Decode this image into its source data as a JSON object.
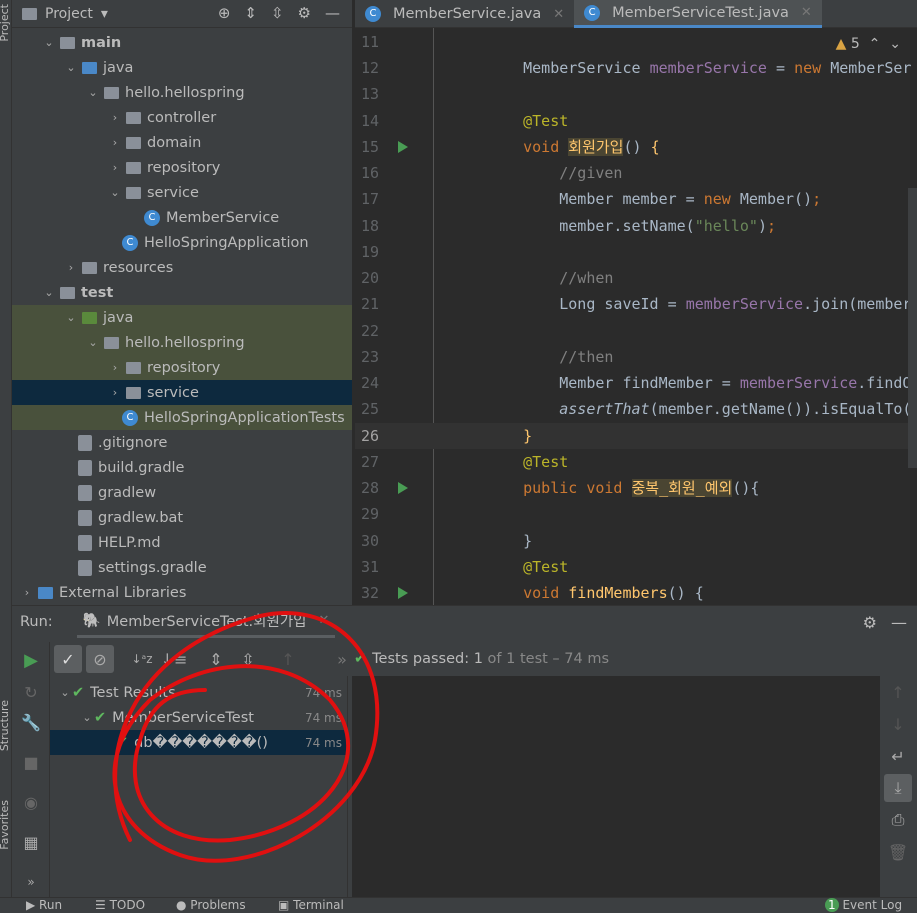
{
  "side_strip": {
    "project": "Project",
    "structure": "Structure",
    "favorites": "Favorites"
  },
  "project_panel": {
    "title": "Project",
    "tree": [
      {
        "label": "main",
        "depth": 1,
        "kind": "folder",
        "open": true
      },
      {
        "label": "java",
        "depth": 2,
        "kind": "folder-blue",
        "open": true
      },
      {
        "label": "hello.hellospring",
        "depth": 3,
        "kind": "package",
        "open": true
      },
      {
        "label": "controller",
        "depth": 4,
        "kind": "package",
        "open": false
      },
      {
        "label": "domain",
        "depth": 4,
        "kind": "package",
        "open": false
      },
      {
        "label": "repository",
        "depth": 4,
        "kind": "package",
        "open": false
      },
      {
        "label": "service",
        "depth": 4,
        "kind": "package",
        "open": true
      },
      {
        "label": "MemberService",
        "depth": 5,
        "kind": "class"
      },
      {
        "label": "HelloSpringApplication",
        "depth": 4,
        "kind": "class-leaf"
      },
      {
        "label": "resources",
        "depth": 2,
        "kind": "folder",
        "open": false
      },
      {
        "label": "test",
        "depth": 1,
        "kind": "folder",
        "open": true
      },
      {
        "label": "java",
        "depth": 2,
        "kind": "folder-green",
        "open": true,
        "tint": true
      },
      {
        "label": "hello.hellospring",
        "depth": 3,
        "kind": "package",
        "open": true,
        "tint": true
      },
      {
        "label": "repository",
        "depth": 4,
        "kind": "package",
        "open": false,
        "tint": true
      },
      {
        "label": "service",
        "depth": 4,
        "kind": "package",
        "open": false,
        "selected": true
      },
      {
        "label": "HelloSpringApplicationTests",
        "depth": 4,
        "kind": "class-leaf",
        "tint": true
      },
      {
        "label": ".gitignore",
        "depth": 2,
        "kind": "file"
      },
      {
        "label": "build.gradle",
        "depth": 2,
        "kind": "file"
      },
      {
        "label": "gradlew",
        "depth": 2,
        "kind": "file"
      },
      {
        "label": "gradlew.bat",
        "depth": 2,
        "kind": "file"
      },
      {
        "label": "HELP.md",
        "depth": 2,
        "kind": "file"
      },
      {
        "label": "settings.gradle",
        "depth": 2,
        "kind": "file"
      },
      {
        "label": "External Libraries",
        "depth": 0,
        "kind": "lib",
        "open": false
      }
    ]
  },
  "tabs": [
    {
      "label": "MemberService.java",
      "active": false
    },
    {
      "label": "MemberServiceTest.java",
      "active": true
    }
  ],
  "inspections": {
    "warnings": "5"
  },
  "editor": {
    "current_line": 26,
    "lines": [
      {
        "n": "11",
        "t": []
      },
      {
        "n": "12",
        "t": [
          [
            "    MemberService ",
            "pl"
          ],
          [
            "memberService",
            "fd"
          ],
          [
            " = ",
            "pl"
          ],
          [
            "new ",
            "kw"
          ],
          [
            "MemberSer",
            "pl"
          ]
        ]
      },
      {
        "n": "13",
        "t": []
      },
      {
        "n": "14",
        "t": [
          [
            "    @Test",
            "an"
          ]
        ]
      },
      {
        "n": "15",
        "run": true,
        "t": [
          [
            "    void ",
            "kw"
          ],
          [
            "회원가입",
            "fn hl"
          ],
          [
            "() ",
            "pl"
          ],
          [
            "{",
            "fn"
          ]
        ]
      },
      {
        "n": "16",
        "t": [
          [
            "        //given",
            "cm"
          ]
        ]
      },
      {
        "n": "17",
        "t": [
          [
            "        Member member = ",
            "pl"
          ],
          [
            "new ",
            "kw"
          ],
          [
            "Member()",
            "pl"
          ],
          [
            ";",
            "kw"
          ]
        ]
      },
      {
        "n": "18",
        "t": [
          [
            "        member.setName(",
            "pl"
          ],
          [
            "\"hello\"",
            "st"
          ],
          [
            ")",
            "pl"
          ],
          [
            ";",
            "kw"
          ]
        ]
      },
      {
        "n": "19",
        "t": []
      },
      {
        "n": "20",
        "t": [
          [
            "        //when",
            "cm"
          ]
        ]
      },
      {
        "n": "21",
        "t": [
          [
            "        Long saveId = ",
            "pl"
          ],
          [
            "memberService",
            "fd"
          ],
          [
            ".join(member",
            "pl"
          ]
        ]
      },
      {
        "n": "22",
        "t": []
      },
      {
        "n": "23",
        "t": [
          [
            "        //then",
            "cm"
          ]
        ]
      },
      {
        "n": "24",
        "t": [
          [
            "        Member findMember = ",
            "pl"
          ],
          [
            "memberService",
            "fd"
          ],
          [
            ".findO",
            "pl"
          ]
        ]
      },
      {
        "n": "25",
        "t": [
          [
            "        assertThat",
            "pl it"
          ],
          [
            "(member.getName()).isEqualTo(",
            "pl"
          ]
        ]
      },
      {
        "n": "26",
        "t": [
          [
            "    }",
            "fn"
          ]
        ]
      },
      {
        "n": "27",
        "t": [
          [
            "    @Test",
            "an"
          ]
        ]
      },
      {
        "n": "28",
        "run": true,
        "t": [
          [
            "    public void ",
            "kw"
          ],
          [
            "중복_회원_예외",
            "fn hl"
          ],
          [
            "(){",
            "pl"
          ]
        ]
      },
      {
        "n": "29",
        "t": []
      },
      {
        "n": "30",
        "t": [
          [
            "    }",
            "pl"
          ]
        ]
      },
      {
        "n": "31",
        "t": [
          [
            "    @Test",
            "an"
          ]
        ]
      },
      {
        "n": "32",
        "run": true,
        "t": [
          [
            "    void ",
            "kw"
          ],
          [
            "findMembers",
            "fn"
          ],
          [
            "() {",
            "pl"
          ]
        ]
      }
    ]
  },
  "run": {
    "label": "Run:",
    "tab": "MemberServiceTest.회원가입",
    "status": {
      "prefix": "Tests passed: ",
      "count": "1",
      "suffix": " of 1 test – 74 ms"
    },
    "results": [
      {
        "label": "Test Results",
        "time": "74 ms",
        "depth": 0
      },
      {
        "label": "MemberServiceTest",
        "time": "74 ms",
        "depth": 1
      },
      {
        "label": "db�������()",
        "time": "74 ms",
        "depth": 2,
        "selected": true
      }
    ]
  },
  "bottom_bar": {
    "run": "Run",
    "todo": "TODO",
    "problems": "Problems",
    "terminal": "Terminal",
    "event_log": "Event Log",
    "event_count": "1"
  },
  "colors": {
    "accent": "#4a88c7",
    "pass": "#5fb85f",
    "annotation": "#e01010"
  }
}
